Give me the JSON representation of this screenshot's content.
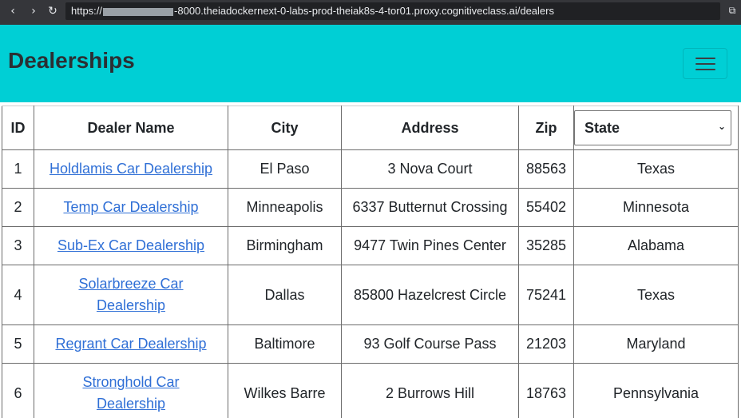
{
  "browser": {
    "url_prefix": "https://",
    "url_suffix": "-8000.theiadockernext-0-labs-prod-theiak8s-4-tor01.proxy.cognitiveclass.ai/dealers",
    "back_icon": "‹",
    "forward_icon": "›",
    "reload_icon": "↻",
    "popout_icon": "⧉"
  },
  "navbar": {
    "brand": "Dealerships",
    "background": "#00cfd5"
  },
  "table": {
    "headers": {
      "id": "ID",
      "name": "Dealer Name",
      "city": "City",
      "address": "Address",
      "zip": "Zip"
    },
    "state_filter": {
      "selected": "State",
      "arrow": "⌄"
    },
    "rows": [
      {
        "id": "1",
        "name": "Holdlamis Car Dealership",
        "city": "El Paso",
        "address": "3 Nova Court",
        "zip": "88563",
        "state": "Texas"
      },
      {
        "id": "2",
        "name": "Temp Car Dealership",
        "city": "Minneapolis",
        "address": "6337 Butternut Crossing",
        "zip": "55402",
        "state": "Minnesota"
      },
      {
        "id": "3",
        "name": "Sub-Ex Car Dealership",
        "city": "Birmingham",
        "address": "9477 Twin Pines Center",
        "zip": "35285",
        "state": "Alabama"
      },
      {
        "id": "4",
        "name": "Solarbreeze Car Dealership",
        "city": "Dallas",
        "address": "85800 Hazelcrest Circle",
        "zip": "75241",
        "state": "Texas"
      },
      {
        "id": "5",
        "name": "Regrant Car Dealership",
        "city": "Baltimore",
        "address": "93 Golf Course Pass",
        "zip": "21203",
        "state": "Maryland"
      },
      {
        "id": "6",
        "name": "Stronghold Car Dealership",
        "city": "Wilkes Barre",
        "address": "2 Burrows Hill",
        "zip": "18763",
        "state": "Pennsylvania"
      }
    ]
  }
}
